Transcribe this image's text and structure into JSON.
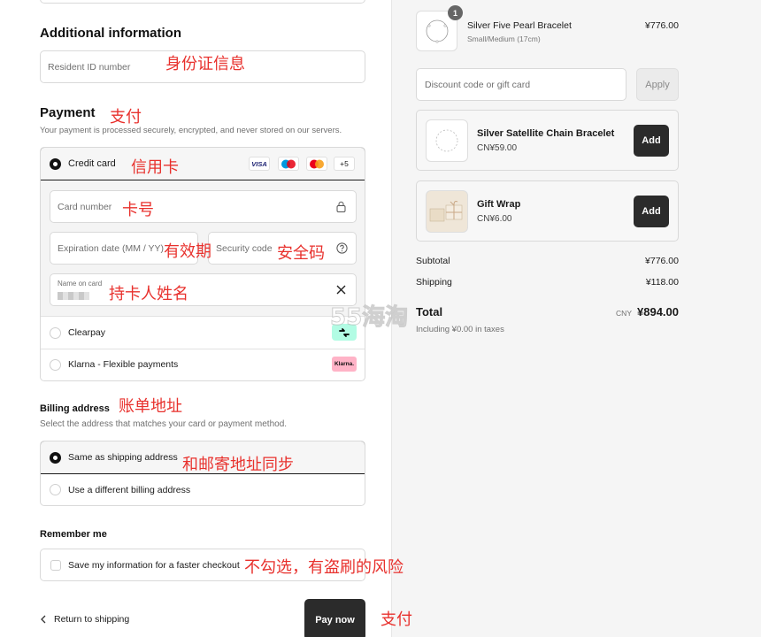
{
  "additional": {
    "heading": "Additional information",
    "resident_id_placeholder": "Resident ID number",
    "note": "身份证信息"
  },
  "payment": {
    "heading": "Payment",
    "heading_note": "支付",
    "subtitle": "Your payment is processed securely, encrypted, and never stored on our servers.",
    "credit_card_label": "Credit card",
    "credit_card_note": "信用卡",
    "card_badges": [
      "VISA",
      "maestro",
      "mastercard",
      "+5"
    ],
    "card_number_placeholder": "Card number",
    "card_number_note": "卡号",
    "expiration_placeholder": "Expiration date (MM / YY)",
    "expiration_note": "有效期",
    "security_placeholder": "Security code",
    "security_note": "安全码",
    "name_on_card_label": "Name on card",
    "name_on_card_note": "持卡人姓名",
    "clearpay_label": "Clearpay",
    "klarna_label": "Klarna - Flexible payments",
    "klarna_logo": "Klarna."
  },
  "billing": {
    "heading": "Billing address",
    "heading_note": "账单地址",
    "subtitle": "Select the address that matches your card or payment method.",
    "same_label": "Same as shipping address",
    "same_note": "和邮寄地址同步",
    "different_label": "Use a different billing address"
  },
  "remember": {
    "heading": "Remember me",
    "checkbox_label": "Save my information for a faster checkout",
    "note": "不勾选，有盗刷的风险"
  },
  "footer": {
    "return_label": "Return to shipping",
    "pay_label": "Pay now",
    "pay_note": "支付"
  },
  "cart": {
    "item": {
      "name": "Silver Five Pearl Bracelet",
      "variant": "Small/Medium (17cm)",
      "price": "¥776.00",
      "quantity": "1"
    },
    "discount_placeholder": "Discount code or gift card",
    "apply_label": "Apply",
    "upsells": [
      {
        "name": "Silver Satellite Chain Bracelet",
        "price": "CN¥59.00",
        "button": "Add"
      },
      {
        "name": "Gift Wrap",
        "price": "CN¥6.00",
        "button": "Add"
      }
    ],
    "subtotal_label": "Subtotal",
    "subtotal_value": "¥776.00",
    "shipping_label": "Shipping",
    "shipping_value": "¥118.00",
    "total_label": "Total",
    "total_currency": "CNY",
    "total_value": "¥894.00",
    "tax_note": "Including ¥0.00 in taxes"
  },
  "watermark": "55海淘",
  "colors": {
    "annotation": "#e8312d",
    "button": "#2b2b2b",
    "panel": "#f5f5f5"
  }
}
